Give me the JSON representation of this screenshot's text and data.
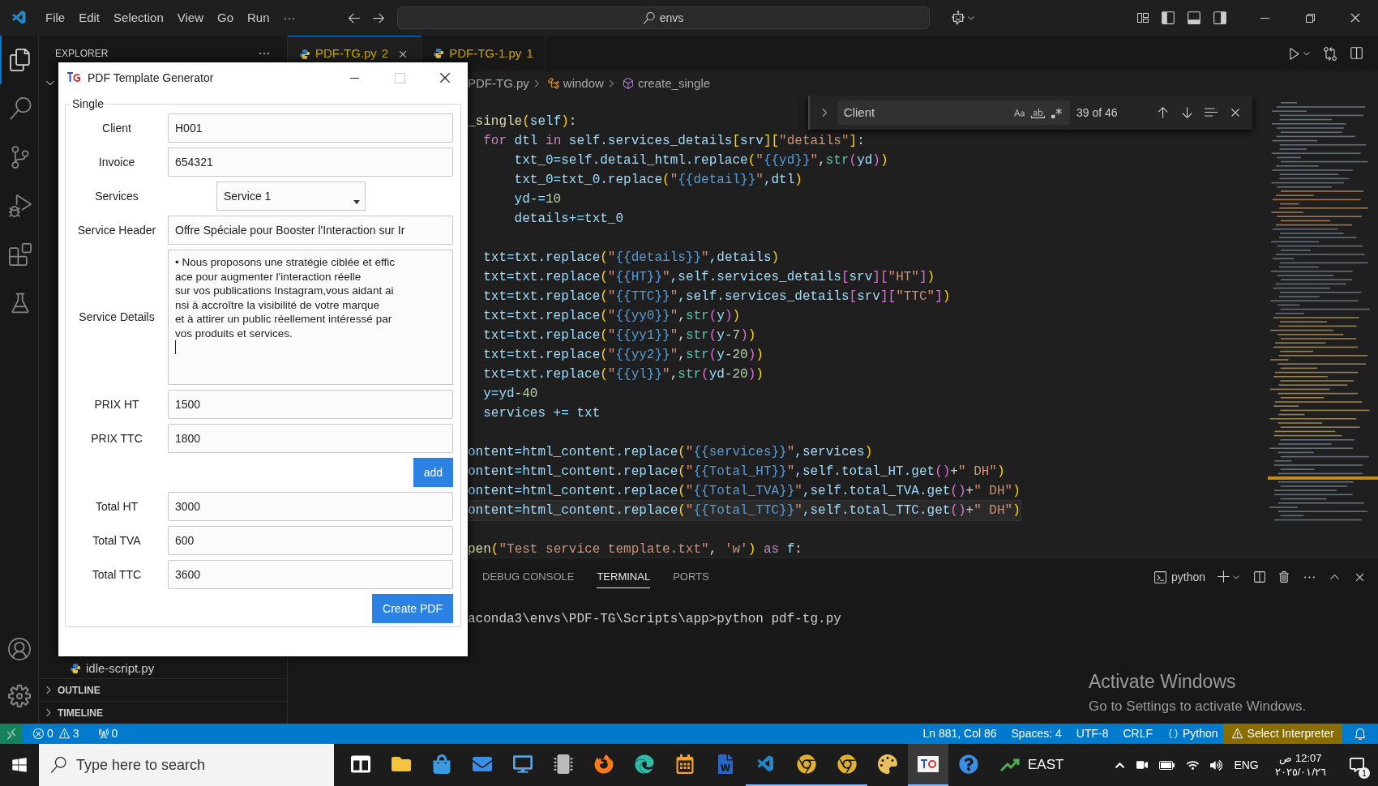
{
  "title_bar": {
    "menu": [
      "File",
      "Edit",
      "Selection",
      "View",
      "Go",
      "Run",
      "···"
    ],
    "search": {
      "value": "envs"
    }
  },
  "activity_bar": [
    {
      "kind": "files",
      "selected": true
    },
    {
      "kind": "search",
      "selected": false
    },
    {
      "kind": "source-control",
      "selected": false
    },
    {
      "kind": "debug",
      "selected": false
    },
    {
      "kind": "extensions",
      "selected": false
    },
    {
      "kind": "testing",
      "selected": false
    }
  ],
  "sidebar": {
    "title": "EXPLORER",
    "files": [
      {
        "name": "idle-script.py"
      }
    ],
    "sections": [
      {
        "label": "OUTLINE",
        "expanded": false
      },
      {
        "label": "TIMELINE",
        "expanded": false
      }
    ]
  },
  "tabs": [
    {
      "label": "PDF-TG.py",
      "badge": "2",
      "selected": true
    },
    {
      "label": "PDF-TG-1.py",
      "badge": "1",
      "selected": false
    }
  ],
  "breadcrumbs": [
    {
      "label": "PDF-TG.py",
      "kind": "file"
    },
    {
      "label": "window",
      "kind": "class"
    },
    {
      "label": "create_single",
      "kind": "method"
    }
  ],
  "find_widget": {
    "value": "Client",
    "match_count": "39 of 46"
  },
  "code": {
    "lines": [
      {
        "kind": "code",
        "current": false,
        "tokens": [
          {
            "text": "_single",
            "kind": "f"
          },
          {
            "text": "(",
            "kind": "b1"
          },
          {
            "text": "self",
            "kind": "v"
          },
          {
            "text": ")",
            "kind": "b1"
          },
          {
            "text": ":",
            "kind": "o"
          }
        ]
      },
      {
        "kind": "code",
        "current": false,
        "tokens": [
          {
            "text": "  for",
            "kind": "k"
          },
          {
            "text": " dtl ",
            "kind": "v"
          },
          {
            "text": "in",
            "kind": "k"
          },
          {
            "text": " self.services_details",
            "kind": "v"
          },
          {
            "text": "[",
            "kind": "b1"
          },
          {
            "text": "srv",
            "kind": "v"
          },
          {
            "text": "]",
            "kind": "b1"
          },
          {
            "text": "[",
            "kind": "b1"
          },
          {
            "text": "\"details\"",
            "kind": "s"
          },
          {
            "text": "]",
            "kind": "b1"
          },
          {
            "text": ":",
            "kind": "o"
          }
        ]
      },
      {
        "kind": "code",
        "current": false,
        "tokens": [
          {
            "text": "      txt_0=self.detail_html.replace",
            "kind": "v"
          },
          {
            "text": "(",
            "kind": "b1"
          },
          {
            "text": "\"",
            "kind": "s"
          },
          {
            "text": "{{yd}}",
            "kind": "t"
          },
          {
            "text": "\"",
            "kind": "s"
          },
          {
            "text": ",",
            "kind": "o"
          },
          {
            "text": "str",
            "kind": "c"
          },
          {
            "text": "(",
            "kind": "b2"
          },
          {
            "text": "yd",
            "kind": "v"
          },
          {
            "text": ")",
            "kind": "b2"
          },
          {
            "text": ")",
            "kind": "b1"
          }
        ]
      },
      {
        "kind": "code",
        "current": false,
        "tokens": [
          {
            "text": "      txt_0=txt_0.replace",
            "kind": "v"
          },
          {
            "text": "(",
            "kind": "b1"
          },
          {
            "text": "\"",
            "kind": "s"
          },
          {
            "text": "{{detail}}",
            "kind": "t"
          },
          {
            "text": "\"",
            "kind": "s"
          },
          {
            "text": ",dtl",
            "kind": "v"
          },
          {
            "text": ")",
            "kind": "b1"
          }
        ]
      },
      {
        "kind": "code",
        "current": false,
        "tokens": [
          {
            "text": "      yd-=",
            "kind": "v"
          },
          {
            "text": "10",
            "kind": "n"
          }
        ]
      },
      {
        "kind": "code",
        "current": false,
        "tokens": [
          {
            "text": "      details+=txt_0",
            "kind": "v"
          }
        ]
      },
      {
        "kind": "blank"
      },
      {
        "kind": "code",
        "current": false,
        "tokens": [
          {
            "text": "  txt=txt.replace",
            "kind": "v"
          },
          {
            "text": "(",
            "kind": "b1"
          },
          {
            "text": "\"",
            "kind": "s"
          },
          {
            "text": "{{details}}",
            "kind": "t"
          },
          {
            "text": "\"",
            "kind": "s"
          },
          {
            "text": ",details",
            "kind": "v"
          },
          {
            "text": ")",
            "kind": "b1"
          }
        ]
      },
      {
        "kind": "code",
        "current": false,
        "tokens": [
          {
            "text": "  txt=txt.replace",
            "kind": "v"
          },
          {
            "text": "(",
            "kind": "b1"
          },
          {
            "text": "\"",
            "kind": "s"
          },
          {
            "text": "{{HT}}",
            "kind": "t"
          },
          {
            "text": "\"",
            "kind": "s"
          },
          {
            "text": ",self.services_details",
            "kind": "v"
          },
          {
            "text": "[",
            "kind": "b2"
          },
          {
            "text": "srv",
            "kind": "v"
          },
          {
            "text": "]",
            "kind": "b2"
          },
          {
            "text": "[",
            "kind": "b2"
          },
          {
            "text": "\"HT\"",
            "kind": "s"
          },
          {
            "text": "]",
            "kind": "b2"
          },
          {
            "text": ")",
            "kind": "b1"
          }
        ]
      },
      {
        "kind": "code",
        "current": false,
        "tokens": [
          {
            "text": "  txt=txt.replace",
            "kind": "v"
          },
          {
            "text": "(",
            "kind": "b1"
          },
          {
            "text": "\"",
            "kind": "s"
          },
          {
            "text": "{{TTC}}",
            "kind": "t"
          },
          {
            "text": "\"",
            "kind": "s"
          },
          {
            "text": ",self.services_details",
            "kind": "v"
          },
          {
            "text": "[",
            "kind": "b2"
          },
          {
            "text": "srv",
            "kind": "v"
          },
          {
            "text": "]",
            "kind": "b2"
          },
          {
            "text": "[",
            "kind": "b2"
          },
          {
            "text": "\"TTC\"",
            "kind": "s"
          },
          {
            "text": "]",
            "kind": "b2"
          },
          {
            "text": ")",
            "kind": "b1"
          }
        ]
      },
      {
        "kind": "code",
        "current": false,
        "tokens": [
          {
            "text": "  txt=txt.replace",
            "kind": "v"
          },
          {
            "text": "(",
            "kind": "b1"
          },
          {
            "text": "\"",
            "kind": "s"
          },
          {
            "text": "{{yy0}}",
            "kind": "t"
          },
          {
            "text": "\"",
            "kind": "s"
          },
          {
            "text": ",",
            "kind": "o"
          },
          {
            "text": "str",
            "kind": "c"
          },
          {
            "text": "(",
            "kind": "b2"
          },
          {
            "text": "y",
            "kind": "v"
          },
          {
            "text": ")",
            "kind": "b2"
          },
          {
            "text": ")",
            "kind": "b1"
          }
        ]
      },
      {
        "kind": "code",
        "current": false,
        "tokens": [
          {
            "text": "  txt=txt.replace",
            "kind": "v"
          },
          {
            "text": "(",
            "kind": "b1"
          },
          {
            "text": "\"",
            "kind": "s"
          },
          {
            "text": "{{yy1}}",
            "kind": "t"
          },
          {
            "text": "\"",
            "kind": "s"
          },
          {
            "text": ",",
            "kind": "o"
          },
          {
            "text": "str",
            "kind": "c"
          },
          {
            "text": "(",
            "kind": "b2"
          },
          {
            "text": "y-",
            "kind": "v"
          },
          {
            "text": "7",
            "kind": "n"
          },
          {
            "text": ")",
            "kind": "b2"
          },
          {
            "text": ")",
            "kind": "b1"
          }
        ]
      },
      {
        "kind": "code",
        "current": false,
        "tokens": [
          {
            "text": "  txt=txt.replace",
            "kind": "v"
          },
          {
            "text": "(",
            "kind": "b1"
          },
          {
            "text": "\"",
            "kind": "s"
          },
          {
            "text": "{{yy2}}",
            "kind": "t"
          },
          {
            "text": "\"",
            "kind": "s"
          },
          {
            "text": ",",
            "kind": "o"
          },
          {
            "text": "str",
            "kind": "c"
          },
          {
            "text": "(",
            "kind": "b2"
          },
          {
            "text": "y-",
            "kind": "v"
          },
          {
            "text": "20",
            "kind": "n"
          },
          {
            "text": ")",
            "kind": "b2"
          },
          {
            "text": ")",
            "kind": "b1"
          }
        ]
      },
      {
        "kind": "code",
        "current": false,
        "tokens": [
          {
            "text": "  txt=txt.replace",
            "kind": "v"
          },
          {
            "text": "(",
            "kind": "b1"
          },
          {
            "text": "\"",
            "kind": "s"
          },
          {
            "text": "{{yl}}",
            "kind": "t"
          },
          {
            "text": "\"",
            "kind": "s"
          },
          {
            "text": ",",
            "kind": "o"
          },
          {
            "text": "str",
            "kind": "c"
          },
          {
            "text": "(",
            "kind": "b2"
          },
          {
            "text": "yd-",
            "kind": "v"
          },
          {
            "text": "20",
            "kind": "n"
          },
          {
            "text": ")",
            "kind": "b2"
          },
          {
            "text": ")",
            "kind": "b1"
          }
        ]
      },
      {
        "kind": "code",
        "current": false,
        "tokens": [
          {
            "text": "  y=yd-",
            "kind": "v"
          },
          {
            "text": "40",
            "kind": "n"
          }
        ]
      },
      {
        "kind": "code",
        "current": false,
        "tokens": [
          {
            "text": "  services += txt",
            "kind": "v"
          }
        ]
      },
      {
        "kind": "blank"
      },
      {
        "kind": "code",
        "current": false,
        "tokens": [
          {
            "text": "ontent=html_content.replace",
            "kind": "v"
          },
          {
            "text": "(",
            "kind": "b1"
          },
          {
            "text": "\"",
            "kind": "s"
          },
          {
            "text": "{{services}}",
            "kind": "t"
          },
          {
            "text": "\"",
            "kind": "s"
          },
          {
            "text": ",services",
            "kind": "v"
          },
          {
            "text": ")",
            "kind": "b1"
          }
        ]
      },
      {
        "kind": "code",
        "current": false,
        "tokens": [
          {
            "text": "ontent=html_content.replace",
            "kind": "v"
          },
          {
            "text": "(",
            "kind": "b1"
          },
          {
            "text": "\"",
            "kind": "s"
          },
          {
            "text": "{{Total_HT}}",
            "kind": "t"
          },
          {
            "text": "\"",
            "kind": "s"
          },
          {
            "text": ",self.total_HT.get",
            "kind": "v"
          },
          {
            "text": "()",
            "kind": "b2"
          },
          {
            "text": "+",
            "kind": "o"
          },
          {
            "text": "\" DH\"",
            "kind": "s"
          },
          {
            "text": ")",
            "kind": "b1"
          }
        ]
      },
      {
        "kind": "code",
        "current": false,
        "tokens": [
          {
            "text": "ontent=html_content.replace",
            "kind": "v"
          },
          {
            "text": "(",
            "kind": "b1"
          },
          {
            "text": "\"",
            "kind": "s"
          },
          {
            "text": "{{Total_TVA}}",
            "kind": "t"
          },
          {
            "text": "\"",
            "kind": "s"
          },
          {
            "text": ",self.total_TVA.get",
            "kind": "v"
          },
          {
            "text": "()",
            "kind": "b2"
          },
          {
            "text": "+",
            "kind": "o"
          },
          {
            "text": "\" DH\"",
            "kind": "s"
          },
          {
            "text": ")",
            "kind": "b1"
          }
        ]
      },
      {
        "kind": "code",
        "current": true,
        "tokens": [
          {
            "text": "ontent=html_content.replace",
            "kind": "v"
          },
          {
            "text": "(",
            "kind": "b1"
          },
          {
            "text": "\"",
            "kind": "s"
          },
          {
            "text": "{{Total_TTC}}",
            "kind": "t"
          },
          {
            "text": "\"",
            "kind": "s"
          },
          {
            "text": ",self.total_TTC.get",
            "kind": "v"
          },
          {
            "text": "()",
            "kind": "b2"
          },
          {
            "text": "+",
            "kind": "o"
          },
          {
            "text": "\" DH\"",
            "kind": "s"
          },
          {
            "text": ")",
            "kind": "b1"
          }
        ]
      },
      {
        "kind": "blank"
      },
      {
        "kind": "code",
        "current": false,
        "tokens": [
          {
            "text": "pen",
            "kind": "f"
          },
          {
            "text": "(",
            "kind": "b1"
          },
          {
            "text": "\"Test service template.txt\"",
            "kind": "s"
          },
          {
            "text": ", ",
            "kind": "o"
          },
          {
            "text": "'w'",
            "kind": "s"
          },
          {
            "text": ")",
            "kind": "b1"
          },
          {
            "text": " as ",
            "kind": "k"
          },
          {
            "text": "f",
            "kind": "v"
          },
          {
            "text": ":",
            "kind": "o"
          }
        ]
      }
    ]
  },
  "panel": {
    "tabs": [
      {
        "label": "DEBUG CONSOLE",
        "selected": false
      },
      {
        "label": "TERMINAL",
        "selected": true
      },
      {
        "label": "PORTS",
        "selected": false
      }
    ],
    "shell": "python",
    "terminal_lines": [
      "aconda3\\envs\\PDF-TG\\Scripts\\app>python pdf-tg.py"
    ]
  },
  "activation_notice": {
    "title": "Activate Windows",
    "text": "Go to Settings to activate Windows."
  },
  "status_bar": {
    "errors": "0",
    "warnings": "3",
    "ports": "0",
    "items": [
      "Ln 881, Col 86",
      "Spaces: 4",
      "UTF-8",
      "CRLF"
    ],
    "language": "Python",
    "interpreter": "Select Interpreter"
  },
  "dialog": {
    "title": "PDF Template Generator",
    "group": "Single",
    "fields": [
      {
        "kind": "entry",
        "label": "Client",
        "value": "H001"
      },
      {
        "kind": "entry",
        "label": "Invoice",
        "value": "654321"
      },
      {
        "kind": "combo",
        "label": "Services",
        "value": "Service 1"
      },
      {
        "kind": "entry",
        "label": "Service Header",
        "value": "Offre Spéciale pour Booster l'Interaction sur Ir"
      },
      {
        "kind": "text",
        "label": "Service Details",
        "lines": [
          "• Nous proposons une stratégie ciblée et effic",
          "ace pour augmenter l'interaction réelle",
          "sur vos publications Instagram,vous aidant ai",
          "nsi à accroître la visibilité de votre marque",
          "et à attirer un public réellement intéressé par",
          "vos produits et services."
        ]
      },
      {
        "kind": "entry",
        "label": "PRIX HT",
        "value": "1500"
      },
      {
        "kind": "entry",
        "label": "PRIX TTC",
        "value": "1800"
      },
      {
        "kind": "button",
        "label": "add"
      },
      {
        "kind": "entry",
        "label": "Total HT",
        "value": "3000"
      },
      {
        "kind": "entry",
        "label": "Total TVA",
        "value": "600"
      },
      {
        "kind": "entry",
        "label": "Total TTC",
        "value": "3600"
      },
      {
        "kind": "button",
        "label": "Create PDF"
      }
    ]
  },
  "taskbar": {
    "search_placeholder": "Type here to search",
    "apps": [
      {
        "kind": "task-view",
        "selected": false,
        "running": false
      },
      {
        "kind": "folder",
        "selected": false,
        "running": false
      },
      {
        "kind": "store",
        "selected": false,
        "running": false
      },
      {
        "kind": "mail",
        "selected": false,
        "running": false
      },
      {
        "kind": "computer",
        "selected": false,
        "running": false
      },
      {
        "kind": "chip",
        "selected": false,
        "running": false
      },
      {
        "kind": "firefox",
        "selected": false,
        "running": false
      },
      {
        "kind": "edge",
        "selected": false,
        "running": false
      },
      {
        "kind": "outlook",
        "selected": false,
        "running": false
      },
      {
        "kind": "word",
        "selected": false,
        "running": false
      },
      {
        "kind": "code",
        "selected": false,
        "running": true
      },
      {
        "kind": "chrome",
        "selected": false,
        "running": true
      },
      {
        "kind": "chrome",
        "selected": false,
        "running": true
      },
      {
        "kind": "paint",
        "selected": false,
        "running": false
      },
      {
        "kind": "tg",
        "selected": true,
        "running": true
      },
      {
        "kind": "help",
        "selected": false,
        "running": false
      }
    ],
    "weather": "EAST",
    "language": "ENG",
    "time": "12:07 ص",
    "date": "٢٠٢٥/٠١/٢٦",
    "notifications": "1"
  }
}
